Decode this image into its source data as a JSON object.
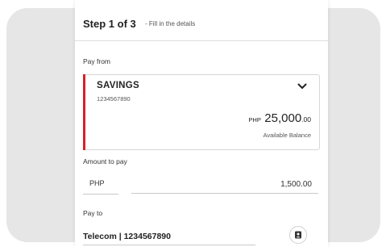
{
  "step": {
    "title": "Step 1 of 3",
    "subtitle": "- Fill in the details"
  },
  "pay_from": {
    "label": "Pay from",
    "account_type": "SAVINGS",
    "account_number": "1234567890",
    "balance_currency": "PHP",
    "balance_amount": "25,000",
    "balance_decimals": ".00",
    "balance_label": "Available Balance",
    "icon": "chevron-down-icon"
  },
  "amount": {
    "label": "Amount to pay",
    "currency": "PHP",
    "value": "1,500.00"
  },
  "pay_to": {
    "label": "Pay to",
    "value": "Telecom | 1234567890",
    "icon": "contact-book-icon"
  },
  "colors": {
    "accent": "#d8202c",
    "backdrop": "#e6e6e6"
  }
}
